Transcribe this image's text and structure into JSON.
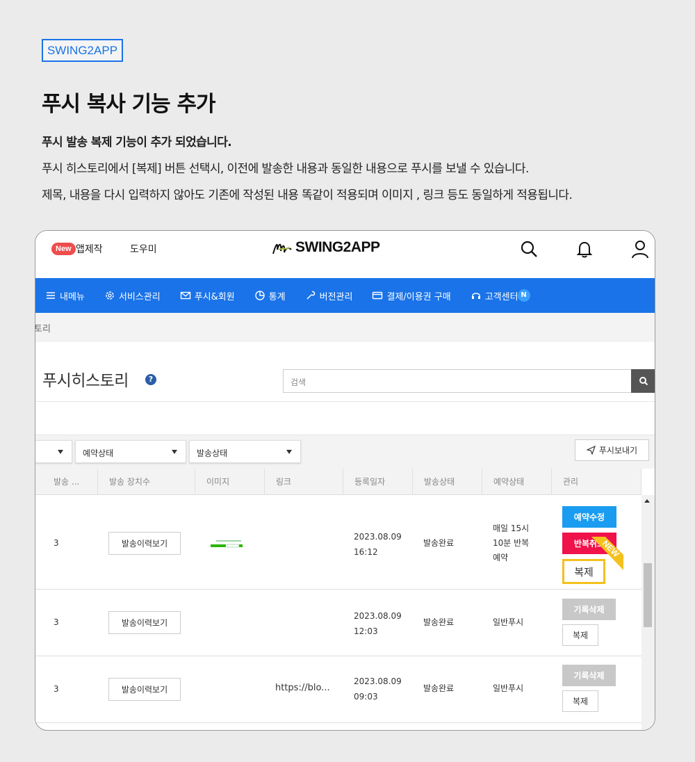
{
  "header": {
    "tag": "SWING2APP",
    "title": "푸시 복사 기능 추가",
    "desc_bold": "푸시 발송 복제 기능이 추가 되었습니다.",
    "desc_line2": "푸시 히스토리에서 [복제] 버튼 선택시, 이전에 발송한 내용과 동일한 내용으로 푸시를 보낼 수 있습니다.",
    "desc_line3": "제목, 내용을 다시 입력하지 않아도 기존에 작성된 내용 똑같이 적용되며 이미지 , 링크 등도 동일하게 적용됩니다."
  },
  "app": {
    "new_badge": "New",
    "make_app": "앱제작",
    "help": "도우미",
    "logo": "SWING2APP",
    "icons": [
      "search-icon",
      "bell-icon",
      "user-icon"
    ]
  },
  "nav": {
    "items": [
      {
        "label": "내메뉴",
        "icon": "menu-icon"
      },
      {
        "label": "서비스관리",
        "icon": "gear-icon"
      },
      {
        "label": "푸시&회원",
        "icon": "mail-icon"
      },
      {
        "label": "통계",
        "icon": "pie-chart-icon"
      },
      {
        "label": "버전관리",
        "icon": "wrench-icon"
      },
      {
        "label": "결제/이용권 구매",
        "icon": "card-icon"
      },
      {
        "label": "고객센터",
        "icon": "headset-icon"
      }
    ],
    "notice_badge": "N"
  },
  "breadcrumb": "토리",
  "page": {
    "title": "푸시히스토리",
    "help_icon": "?",
    "search_placeholder": "검색"
  },
  "filters": {
    "select_reservation": "예약상태",
    "select_send": "발송상태",
    "send_push": "푸시보내기"
  },
  "table": {
    "headers": [
      "발송 ...",
      "발송 장치수",
      "이미지",
      "링크",
      "등록일자",
      "발송상태",
      "예약상태",
      "관리"
    ],
    "history_btn": "발송이력보기",
    "rows": [
      {
        "count": "3",
        "link": "",
        "date": "2023.08.09",
        "time": "16:12",
        "status": "발송완료",
        "reserve_1": "매일 15시",
        "reserve_2": "10분 반복",
        "reserve_3": "예약",
        "btn1": "예약수정",
        "btn2": "반복취소",
        "copy": "복제",
        "ribbon": "NEW"
      },
      {
        "count": "3",
        "link": "",
        "date": "2023.08.09",
        "time": "12:03",
        "status": "발송완료",
        "reserve": "일반푸시",
        "btn1": "기록삭제",
        "copy": "복제"
      },
      {
        "count": "3",
        "link": "https://blo...",
        "date": "2023.08.09",
        "time": "09:03",
        "status": "발송완료",
        "reserve": "일반푸시",
        "btn1": "기록삭제",
        "copy": "복제"
      }
    ]
  },
  "colors": {
    "brand_blue": "#1a73e8",
    "edit_blue": "#1a9cf0",
    "cancel_red": "#f0124a",
    "highlight_yellow": "#f4c01c"
  }
}
